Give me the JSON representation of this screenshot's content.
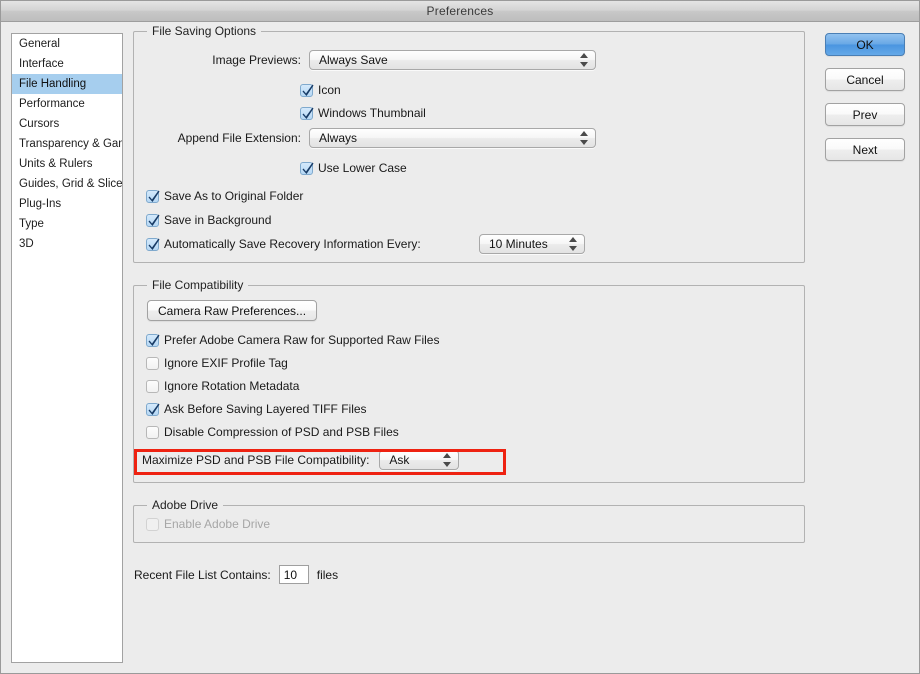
{
  "window": {
    "title": "Preferences"
  },
  "sidebar": {
    "items": [
      {
        "label": "General",
        "selected": false
      },
      {
        "label": "Interface",
        "selected": false
      },
      {
        "label": "File Handling",
        "selected": true
      },
      {
        "label": "Performance",
        "selected": false
      },
      {
        "label": "Cursors",
        "selected": false
      },
      {
        "label": "Transparency & Gamut",
        "selected": false
      },
      {
        "label": "Units & Rulers",
        "selected": false
      },
      {
        "label": "Guides, Grid & Slices",
        "selected": false
      },
      {
        "label": "Plug-Ins",
        "selected": false
      },
      {
        "label": "Type",
        "selected": false
      },
      {
        "label": "3D",
        "selected": false
      }
    ]
  },
  "buttons": {
    "ok": "OK",
    "cancel": "Cancel",
    "prev": "Prev",
    "next": "Next"
  },
  "file_saving_options": {
    "legend": "File Saving Options",
    "image_previews_label": "Image Previews:",
    "image_previews_value": "Always Save",
    "icon_label": "Icon",
    "icon_checked": true,
    "windows_thumbnail_label": "Windows Thumbnail",
    "windows_thumbnail_checked": true,
    "append_file_extension_label": "Append File Extension:",
    "append_file_extension_value": "Always",
    "use_lower_case_label": "Use Lower Case",
    "use_lower_case_checked": true,
    "save_as_original_folder_label": "Save As to Original Folder",
    "save_as_original_folder_checked": true,
    "save_in_background_label": "Save in Background",
    "save_in_background_checked": true,
    "auto_save_recovery_label": "Automatically Save Recovery Information Every:",
    "auto_save_recovery_checked": true,
    "auto_save_recovery_value": "10 Minutes"
  },
  "file_compatibility": {
    "legend": "File Compatibility",
    "camera_raw_button": "Camera Raw Preferences...",
    "prefer_camera_raw_label": "Prefer Adobe Camera Raw for Supported Raw Files",
    "prefer_camera_raw_checked": true,
    "ignore_exif_label": "Ignore EXIF Profile Tag",
    "ignore_exif_checked": false,
    "ignore_rotation_label": "Ignore Rotation Metadata",
    "ignore_rotation_checked": false,
    "ask_layered_tiff_label": "Ask Before Saving Layered TIFF Files",
    "ask_layered_tiff_checked": true,
    "disable_compression_label": "Disable Compression of PSD and PSB Files",
    "disable_compression_checked": false,
    "maximize_compat_label": "Maximize PSD and PSB File Compatibility:",
    "maximize_compat_value": "Ask"
  },
  "adobe_drive": {
    "legend": "Adobe Drive",
    "enable_label": "Enable Adobe Drive",
    "enable_checked": false,
    "enable_disabled": true
  },
  "recent_files": {
    "label": "Recent File List Contains:",
    "value": "10",
    "suffix": "files"
  },
  "colors": {
    "highlight_red": "#ee2211",
    "selection_blue": "#a6ceee",
    "default_button_blue": "#4a95e0",
    "window_bg": "#ececec"
  }
}
